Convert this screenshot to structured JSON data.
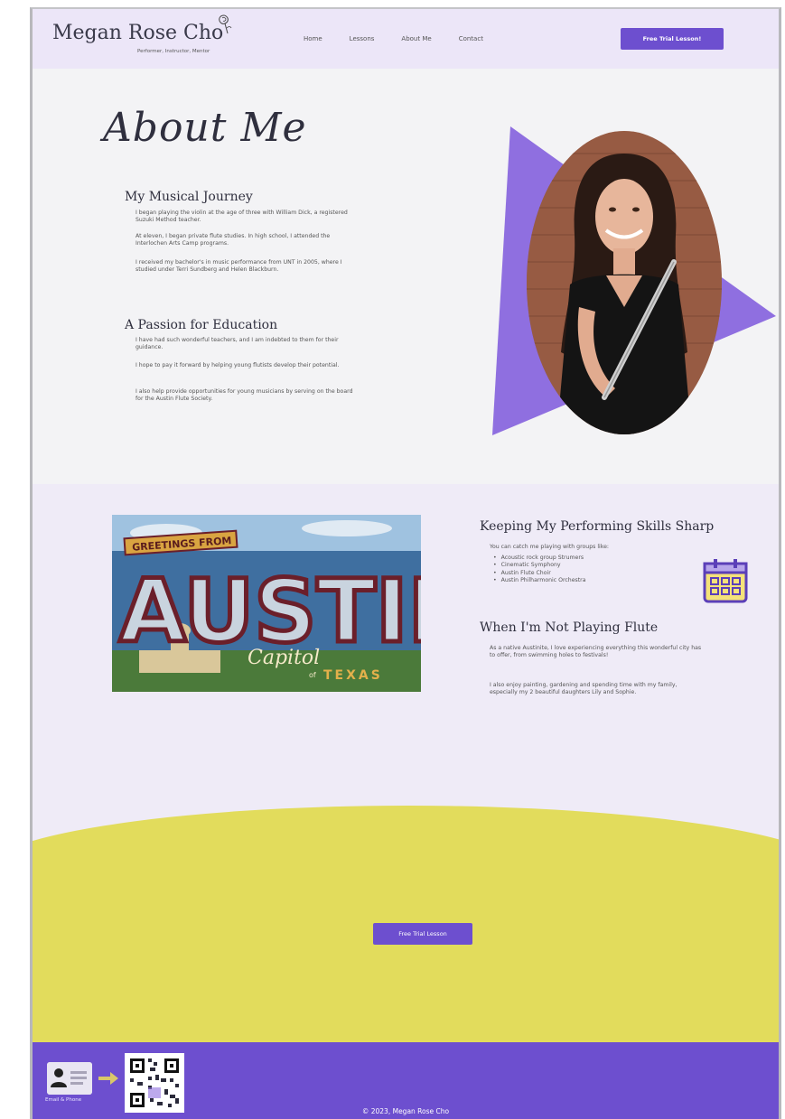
{
  "site": {
    "name": "Megan Rose Cho",
    "tagline": "Performer, Instructor, Mentor"
  },
  "nav": {
    "items": [
      "Home",
      "Lessons",
      "About Me",
      "Contact"
    ],
    "cta": "Free Trial Lesson!"
  },
  "about": {
    "title": "About Me",
    "journey_heading": "My Musical Journey",
    "journey_paragraphs": [
      "I began playing the violin at the age of three with William Dick, a registered Suzuki Method teacher.",
      "At eleven, I began private flute studies. In high school, I attended the Interlochen Arts Camp programs.",
      "I received my bachelor's in music performance from UNT in 2005, where I studied under Terri Sundberg and Helen Blackburn."
    ],
    "education_heading": "A Passion for Education",
    "education_paragraphs": [
      "I have had such wonderful teachers, and I am indebted to them for their guidance.",
      "I hope to pay it forward by helping young flutists develop their potential.",
      "I also help provide opportunities for young musicians by serving on the board for the Austin Flute Society."
    ]
  },
  "postcard": {
    "top_text": "GREETINGS FROM",
    "city": "AUSTIN",
    "script": "Capitol",
    "connector": "of",
    "state": "TEXAS"
  },
  "skills": {
    "heading": "Keeping My Performing Skills Sharp",
    "intro": "You can catch me playing with groups like:",
    "groups": [
      "Acoustic rock group Strumers",
      "Cinematic Symphony",
      "Austin Flute Choir",
      "Austin Philharmonic Orchestra"
    ]
  },
  "not_playing": {
    "heading": "When I'm Not Playing Flute",
    "paragraphs": [
      "As a native Austinite, I love experiencing everything this wonderful city has to offer, from swimming holes to festivals!",
      "I also enjoy painting, gardening and spending time with my family, especially my 2 beautiful daughters Lily and Sophie."
    ]
  },
  "cta_mid": "Free Trial Lesson",
  "footer": {
    "id_caption": "Email & Phone",
    "copyright": "© 2023, Megan Rose Cho"
  },
  "colors": {
    "accent": "#6d4fcf",
    "header_bg": "#ece6f8",
    "yellow": "#e2dc5c",
    "triangle": "#8f6fe0"
  }
}
